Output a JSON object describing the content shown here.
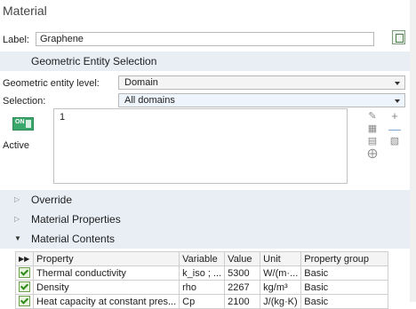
{
  "panel": {
    "title": "Material"
  },
  "label_row": {
    "label": "Label:",
    "value": "Graphene"
  },
  "geometric_selection": {
    "header": "Geometric Entity Selection",
    "level_label": "Geometric entity level:",
    "level_value": "Domain",
    "selection_label": "Selection:",
    "selection_value": "All domains",
    "active_toggle": "ON",
    "active_label": "Active",
    "items": [
      "1"
    ]
  },
  "sections": {
    "override": "Override",
    "material_properties": "Material Properties",
    "material_contents": "Material Contents"
  },
  "contents_table": {
    "headers": [
      "Property",
      "Variable",
      "Value",
      "Unit",
      "Property group"
    ],
    "rows": [
      {
        "property": "Thermal conductivity",
        "variable": "k_iso ; ...",
        "value": "5300",
        "unit": "W/(m·...",
        "group": "Basic"
      },
      {
        "property": "Density",
        "variable": "rho",
        "value": "2267",
        "unit": "kg/m³",
        "group": "Basic"
      },
      {
        "property": "Heat capacity at constant pres...",
        "variable": "Cp",
        "value": "2100",
        "unit": "J/(kg·K)",
        "group": "Basic"
      }
    ]
  },
  "colors": {
    "section_bg": "#e9eef5",
    "check": "#2e8b16",
    "active_toggle": "#3aa86c"
  }
}
